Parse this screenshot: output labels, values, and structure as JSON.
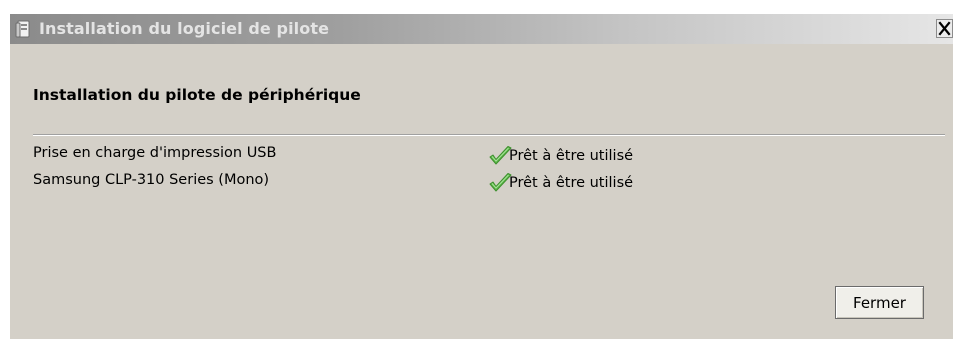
{
  "window": {
    "title": "Installation du logiciel de pilote",
    "title_icon": "driver-installer-icon",
    "close_icon": "close-icon"
  },
  "header": {
    "title": "Installation du pilote de périphérique"
  },
  "devices": [
    {
      "name": "Prise en charge d'impression USB",
      "status": "Prêt à être utilisé",
      "status_icon": "checkmark-icon"
    },
    {
      "name": "Samsung CLP-310 Series (Mono)",
      "status": "Prêt à être utilisé",
      "status_icon": "checkmark-icon"
    }
  ],
  "buttons": {
    "close_label": "Fermer"
  },
  "colors": {
    "dialog_background": "#d4d0c8",
    "checkmark": "#4caf3a"
  }
}
